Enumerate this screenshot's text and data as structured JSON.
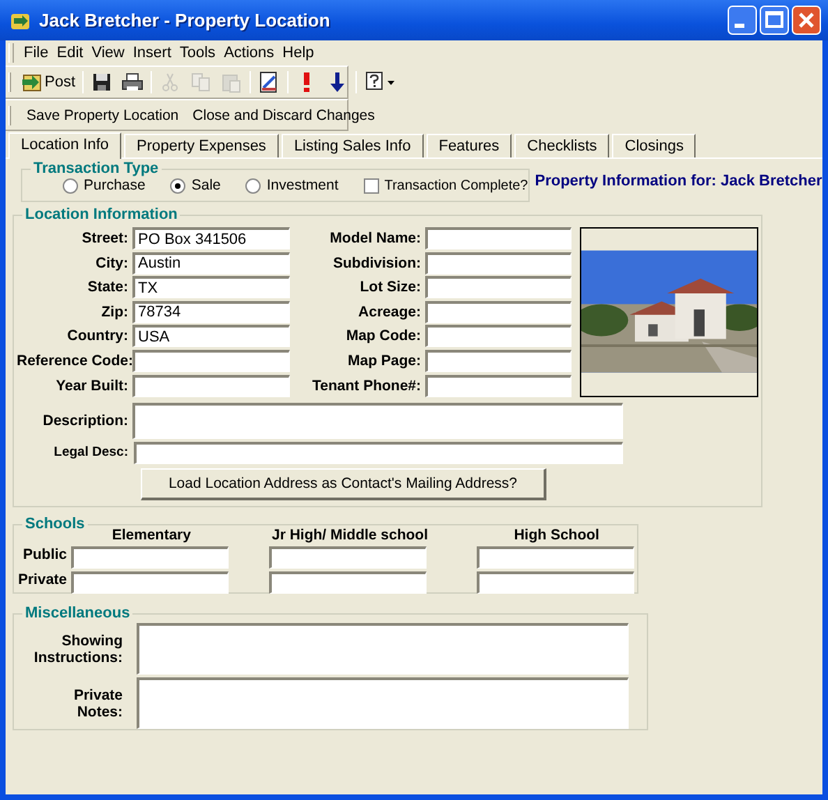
{
  "window": {
    "title": "Jack Bretcher - Property Location"
  },
  "menu": [
    {
      "label": "File"
    },
    {
      "label": "Edit"
    },
    {
      "label": "View"
    },
    {
      "label": "Insert"
    },
    {
      "label": "Tools"
    },
    {
      "label": "Actions"
    },
    {
      "label": "Help"
    }
  ],
  "toolbar": [
    {
      "kind": "post",
      "label": "Post",
      "disabled": false
    },
    {
      "kind": "separator"
    },
    {
      "kind": "save",
      "disabled": false
    },
    {
      "kind": "print",
      "disabled": false
    },
    {
      "kind": "separator"
    },
    {
      "kind": "cut",
      "disabled": true
    },
    {
      "kind": "copy",
      "disabled": true
    },
    {
      "kind": "paste",
      "disabled": true
    },
    {
      "kind": "separator"
    },
    {
      "kind": "preview",
      "disabled": false
    },
    {
      "kind": "separator"
    },
    {
      "kind": "alert",
      "disabled": false
    },
    {
      "kind": "down",
      "disabled": false
    },
    {
      "kind": "separator"
    },
    {
      "kind": "help",
      "disabled": false
    }
  ],
  "actions": [
    {
      "label": "Save Property Location"
    },
    {
      "label": "Close and Discard Changes"
    }
  ],
  "tabs": [
    {
      "label": "Location Info",
      "selected": true
    },
    {
      "label": "Property Expenses",
      "selected": false
    },
    {
      "label": "Listing Sales Info",
      "selected": false
    },
    {
      "label": "Features",
      "selected": false
    },
    {
      "label": "Checklists",
      "selected": false
    },
    {
      "label": "Closings",
      "selected": false
    }
  ],
  "transaction_type": {
    "title": "Transaction Type",
    "options": [
      {
        "label": "Purchase",
        "selected": false
      },
      {
        "label": "Sale",
        "selected": true
      },
      {
        "label": "Investment",
        "selected": false
      }
    ],
    "complete": {
      "label": "Transaction Complete?",
      "checked": false
    }
  },
  "property_info": "Property Information for: Jack Bretcher",
  "location": {
    "title": "Location Information",
    "left_fields": [
      {
        "label": "Street:",
        "value": "PO Box 341506"
      },
      {
        "label": "City:",
        "value": "Austin"
      },
      {
        "label": "State:",
        "value": "TX"
      },
      {
        "label": "Zip:",
        "value": "78734"
      },
      {
        "label": "Country:",
        "value": "USA"
      },
      {
        "label": "Reference Code:"
      },
      {
        "label": "Year Built:"
      }
    ],
    "right_fields": [
      {
        "label": "Model Name:"
      },
      {
        "label": "Subdivision:"
      },
      {
        "label": "Lot Size:"
      },
      {
        "label": "Acreage:"
      },
      {
        "label": "Map Code:"
      },
      {
        "label": "Map Page:"
      },
      {
        "label": "Tenant Phone#:"
      }
    ],
    "description": {
      "label": "Description:"
    },
    "legal_desc": {
      "label": "Legal Desc:"
    },
    "button": "Load Location Address as Contact's Mailing Address?"
  },
  "schools": {
    "title": "Schools",
    "columns": [
      "Elementary",
      "Jr High/ Middle school",
      "High School"
    ],
    "rows": [
      {
        "label": "Public"
      },
      {
        "label": "Private"
      }
    ]
  },
  "miscellaneous": {
    "title": "Miscellaneous",
    "fields": [
      {
        "label": "Showing\nInstructions:"
      },
      {
        "label": "Private\nNotes:"
      }
    ]
  }
}
